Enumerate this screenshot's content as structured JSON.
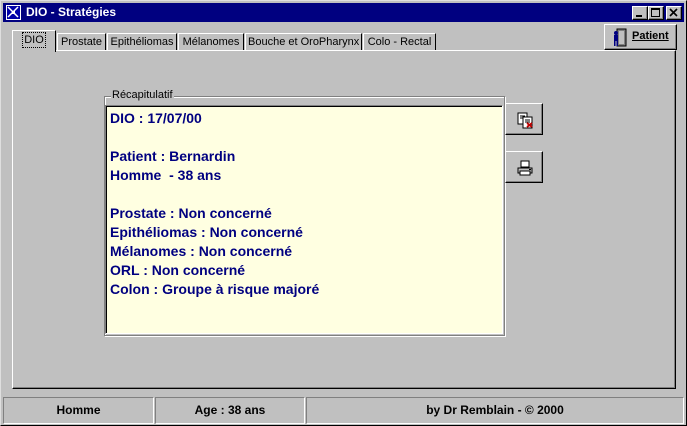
{
  "window": {
    "title": "DIO - Stratégies"
  },
  "tabs": [
    {
      "label": "DIO",
      "active": true
    },
    {
      "label": "Prostate"
    },
    {
      "label": "Epithéliomas"
    },
    {
      "label": "Mélanomes"
    },
    {
      "label": "Bouche et OroPharynx"
    },
    {
      "label": "Colo - Rectal"
    }
  ],
  "patient_button": {
    "label": "Patient",
    "icon": "patient-door-icon"
  },
  "summary": {
    "group_label": "Récapitulatif",
    "lines": [
      "DIO : 17/07/00",
      "",
      "Patient : Bernardin",
      "Homme  - 38 ans",
      "",
      "Prostate : Non concerné",
      "Epithéliomas : Non concerné",
      "Mélanomes : Non concerné",
      "ORL : Non concerné",
      "Colon : Groupe à risque majoré"
    ],
    "text_color": "#000080",
    "background": "#ffffe1"
  },
  "side_buttons": [
    {
      "icon": "copy-document-icon"
    },
    {
      "icon": "printer-icon"
    }
  ],
  "status_bar": {
    "sex": "Homme",
    "age": "Age : 38 ans",
    "credit": "by Dr Remblain - © 2000"
  },
  "colors": {
    "titlebar": "#000080",
    "face": "#c0c0c0"
  }
}
